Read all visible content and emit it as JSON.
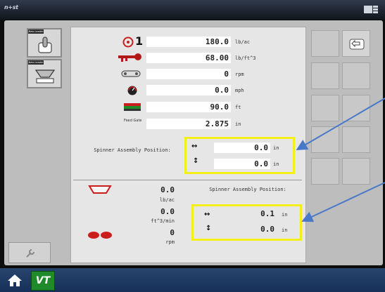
{
  "topbar": {
    "logo_text": "n+st"
  },
  "sidebar": {
    "buttons": [
      {
        "label": "New Leader",
        "icon": "lever-icon"
      },
      {
        "label": "New Leader",
        "icon": "spreader-icon"
      }
    ],
    "wrench_icon": "wrench-icon"
  },
  "main": {
    "rows": [
      {
        "label": "1",
        "value": "180.0",
        "unit": "lb/ac",
        "icon": "target-icon"
      },
      {
        "label": "",
        "value": "68.00",
        "unit": "lb/ft^3",
        "icon": "key-icon"
      },
      {
        "label": "",
        "value": "0",
        "unit": "rpm",
        "icon": "belt-icon"
      },
      {
        "label": "",
        "value": "0.0",
        "unit": "mph",
        "icon": "speedometer-icon"
      },
      {
        "label": "",
        "value": "90.0",
        "unit": "ft",
        "icon": "spread-width-icon"
      },
      {
        "label": "Feed Gate",
        "value": "2.875",
        "unit": "in",
        "icon": ""
      }
    ],
    "spinner_top": {
      "label": "Spinner Assembly Position:",
      "horizontal": {
        "value": "0.0",
        "unit": "in"
      },
      "vertical": {
        "value": "0.0",
        "unit": "in"
      }
    },
    "status": {
      "values": [
        {
          "value": "0.0",
          "unit": "lb/ac"
        },
        {
          "value": "0.0",
          "unit": "ft^3/min"
        },
        {
          "value": "0",
          "unit": "rpm"
        }
      ],
      "spinner_label": "Spinner Assembly Position:",
      "horizontal": {
        "value": "0.1",
        "unit": "in"
      },
      "vertical": {
        "value": "0.0",
        "unit": "in"
      }
    }
  },
  "right_grid": {
    "back_icon": "back-arrow-icon"
  },
  "bottombar": {
    "home_icon": "home-icon",
    "vt_label": "VT"
  },
  "colors": {
    "highlight": "#f4ee1b",
    "arrow": "#4a78c8",
    "bottom_bar": "#1d3a66",
    "red": "#cc1d1d"
  }
}
